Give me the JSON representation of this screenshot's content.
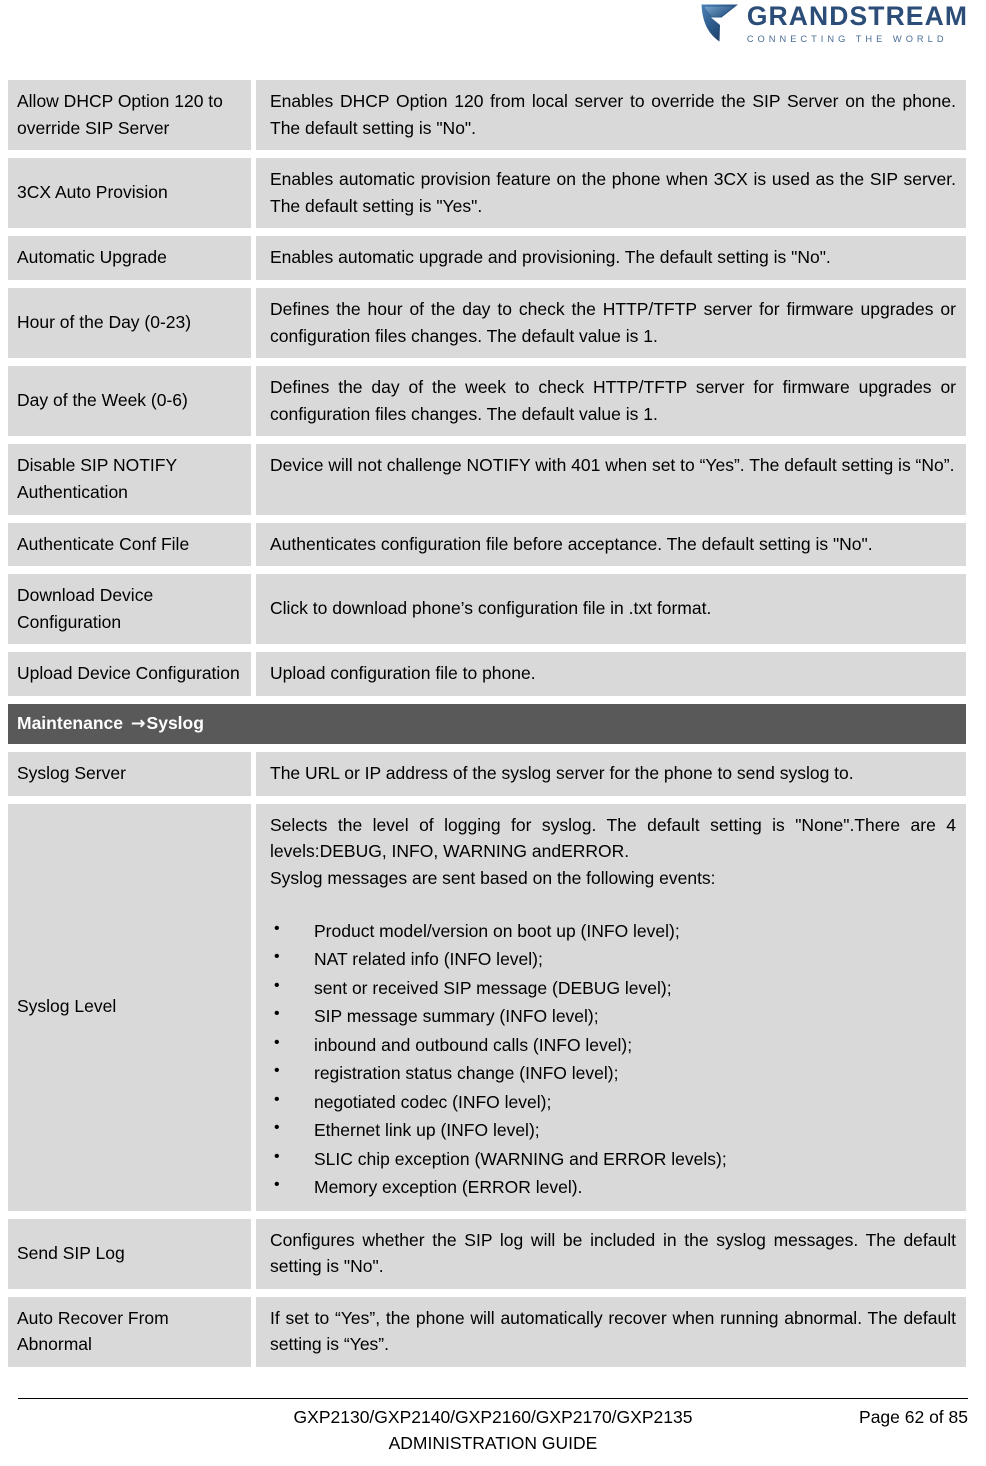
{
  "header": {
    "logo": {
      "mark_name": "grandstream-logo-mark",
      "brand": "GRANDSTREAM",
      "tagline": "CONNECTING THE WORLD",
      "brand_color": "#2c4d77"
    }
  },
  "colors": {
    "cell_background": "#d9d9d9",
    "section_background": "#595959",
    "section_text": "#ffffff",
    "page_background": "#ffffff"
  },
  "table": {
    "rows": [
      {
        "type": "data",
        "label": "Allow DHCP Option 120 to override SIP Server",
        "desc": "Enables DHCP Option 120 from local server to override the SIP Server on the phone. The default setting is \"No\"."
      },
      {
        "type": "data",
        "label": "3CX Auto Provision",
        "desc": "Enables automatic provision feature on the phone when 3CX is used as the SIP server. The default setting is \"Yes\"."
      },
      {
        "type": "data",
        "label": "Automatic Upgrade",
        "desc": "Enables automatic upgrade and provisioning. The default setting is \"No\"."
      },
      {
        "type": "data",
        "label": "Hour of the Day (0-23)",
        "desc": "Defines the hour of the day to check the HTTP/TFTP server for firmware upgrades or configuration files changes. The default value is 1."
      },
      {
        "type": "data",
        "label": "Day of the Week (0-6)",
        "desc": "Defines the day of the week to check HTTP/TFTP server for firmware upgrades or configuration files changes. The default value is 1."
      },
      {
        "type": "data",
        "label": "Disable SIP NOTIFY Authentication",
        "desc": "Device will not challenge NOTIFY with 401 when set to “Yes”. The default setting is “No”."
      },
      {
        "type": "data",
        "label": "Authenticate Conf File",
        "desc": "Authenticates configuration file before acceptance. The default setting is \"No\"."
      },
      {
        "type": "data",
        "label": "Download Device Configuration",
        "desc": "Click to download phone’s configuration file in .txt format."
      },
      {
        "type": "data",
        "label": "Upload Device Configuration",
        "desc": "Upload configuration file to phone."
      },
      {
        "type": "section",
        "section_prefix": "Maintenance ",
        "section_arrow": "→",
        "section_suffix": "Syslog"
      },
      {
        "type": "data",
        "label": "Syslog Server",
        "desc": "The URL or IP address of the syslog server for the phone to send syslog to."
      },
      {
        "type": "data-bullets",
        "label": "Syslog Level",
        "desc_paragraphs": [
          "Selects the level of logging for syslog. The default setting is \"None\".There are 4 levels:DEBUG, INFO, WARNING andERROR.",
          "Syslog messages are sent based on the following events:"
        ],
        "bullets": [
          "Product model/version on boot up (INFO level);",
          "NAT related info (INFO level);",
          "sent or received SIP message (DEBUG level);",
          "SIP message summary (INFO level);",
          "inbound and outbound calls (INFO level);",
          "registration status change (INFO level);",
          "negotiated codec (INFO level);",
          "Ethernet link up (INFO level);",
          "SLIC chip exception (WARNING and ERROR levels);",
          "Memory exception (ERROR level)."
        ]
      },
      {
        "type": "data",
        "label": "Send SIP Log",
        "desc": "Configures whether the SIP log will be included in the syslog messages. The default setting is \"No\"."
      },
      {
        "type": "data",
        "label": "Auto Recover From Abnormal",
        "desc": "If set to “Yes”, the phone will automatically recover when running abnormal. The default setting is “Yes”."
      }
    ]
  },
  "footer": {
    "doc_line1": "GXP2130/GXP2140/GXP2160/GXP2170/GXP2135",
    "doc_line2": "ADMINISTRATION GUIDE",
    "page_label": "Page 62 of 85"
  }
}
